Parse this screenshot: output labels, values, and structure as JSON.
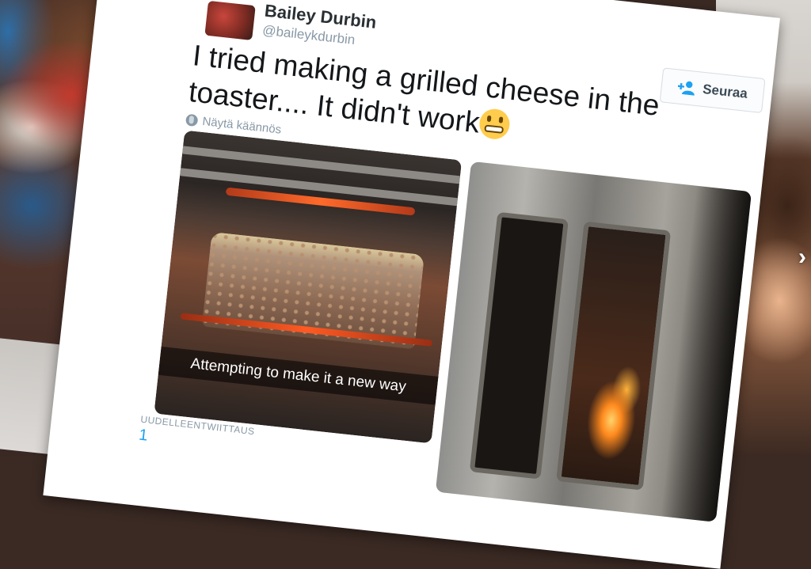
{
  "tweet": {
    "author_name": "Bailey Durbin",
    "author_handle": "@baileykdurbin",
    "text": "I tried making a grilled cheese in the toaster.... It didn't work",
    "emoji": "grimacing-face",
    "translate_label": "Näytä käännös",
    "follow_label": "Seuraa",
    "photo_caption": "Attempting to make it a new way",
    "retweets_label": "UUDELLEENTWIITTAUS",
    "retweets_count": "1"
  },
  "colors": {
    "text": "#14171a",
    "muted": "#8899a6",
    "accent": "#1da1f2",
    "emoji": "#ffcc4d"
  },
  "icons": {
    "follow": "add-user-icon",
    "translate": "globe-icon",
    "prev": "chevron-left-icon",
    "next": "chevron-right-icon"
  }
}
